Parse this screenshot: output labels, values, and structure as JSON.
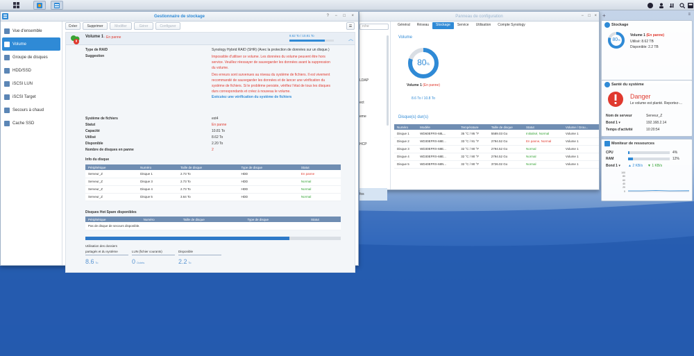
{
  "colors": {
    "accent": "#2f8ad6",
    "error": "#e0392e",
    "ok": "#33a233"
  },
  "taskbar": {
    "icons": [
      "grid-icon",
      "package-center-icon",
      "storage-manager-icon"
    ],
    "right_icons": [
      "chat-icon",
      "user-icon",
      "options-icon",
      "search-icon",
      "widgets-icon"
    ]
  },
  "storage_manager": {
    "title": "Gestionnaire de stockage",
    "sidebar": [
      {
        "label": "Vue d'ensemble",
        "icon": "overview-icon"
      },
      {
        "label": "Volume",
        "icon": "volume-icon"
      },
      {
        "label": "Groupe de disques",
        "icon": "disk-group-icon"
      },
      {
        "label": "HDD/SSD",
        "icon": "hdd-icon"
      },
      {
        "label": "iSCSI LUN",
        "icon": "lun-icon"
      },
      {
        "label": "iSCSI Target",
        "icon": "target-icon"
      },
      {
        "label": "Secours à chaud",
        "icon": "hotspare-icon"
      },
      {
        "label": "Cache SSD",
        "icon": "cache-icon"
      }
    ],
    "toolbar": {
      "create": "Créer",
      "delete": "Supprimer",
      "modify": "Modifier",
      "manage": "Gérer",
      "configure": "Configurer"
    },
    "volume": {
      "name": "Volume 1",
      "status_badge": "- En panne",
      "usage_text": "8.62 To / 10.81 To",
      "usage_fraction": 0.8,
      "fields": {
        "raid_label": "Type de RAID",
        "raid_value": "Synology Hybrid RAID (SHR) (Avec la protection de données sur un disque.)",
        "suggestion_label": "Suggestion",
        "suggestion_lines": [
          "Impossible d'utiliser ce volume. Les données du volume peuvent être hors",
          "service. Veuillez réessayer de sauvegarder les données avant la suppression",
          "du volume.",
          "Des erreurs sont survenues au niveau du système de fichiers. Il est vivement",
          "recommandé de sauvegarder les données et de lancer une vérification du",
          "système de fichiers. Si le problème persiste, vérifiez l'état de tous les disques",
          "durs correspondants et créez à nouveau le volume."
        ],
        "suggestion_link": "Exécutez une vérification du système de fichiers",
        "fs_label": "Système de fichiers",
        "fs_value": "ext4",
        "status_label": "Statut",
        "status_value": "En panne",
        "capacity_label": "Capacité",
        "capacity_value": "10.81 To",
        "used_label": "Utilisé",
        "used_value": "8.62 To",
        "avail_label": "Disponible",
        "avail_value": "2.20 To",
        "failed_label": "Nombre de disques en panne",
        "failed_value": "2"
      },
      "disk_info_title": "Info du disque",
      "disk_table": {
        "headers": [
          "Périphérique",
          "Numéro",
          "Taille de disque",
          "Type de disque",
          "Statut"
        ],
        "rows": [
          [
            "Serveur_Z",
            "Disque 1",
            "2.73 To",
            "HDD",
            "En panne"
          ],
          [
            "Serveur_Z",
            "Disque 3",
            "2.73 To",
            "HDD",
            "Normal"
          ],
          [
            "Serveur_Z",
            "Disque 4",
            "2.73 To",
            "HDD",
            "Normal"
          ],
          [
            "Serveur_Z",
            "Disque 5",
            "3.64 To",
            "HDD",
            "Normal"
          ]
        ]
      },
      "hotspare_title": "Disques Hot Spare disponibles",
      "hotspare_table": {
        "headers": [
          "Périphérique",
          "Numéro",
          "Taille de disque",
          "Type de disque",
          "Statut"
        ],
        "empty": "Pas de disque de secours disponible."
      },
      "usage_bar_fraction": 0.8,
      "stats": [
        {
          "label_line1": "Utilisation des dossiers",
          "label_line2": "partagés et du système",
          "value": "8.6",
          "unit": "To"
        },
        {
          "label_line1": "",
          "label_line2": "LUN (fichier courants)",
          "value": "0",
          "unit": "Octets"
        },
        {
          "label_line1": "",
          "label_line2": "Disponible",
          "value": "2.2",
          "unit": "To"
        }
      ]
    }
  },
  "config_panel": {
    "title": "Panneau de configuration",
    "tabs": [
      "Général",
      "Réseau",
      "Stockage",
      "Service",
      "Utilisation",
      "Compte Synology"
    ],
    "partial_left": [
      "LDAP",
      "ect",
      "eme",
      "HCP",
      "fos"
    ],
    "search_placeholder": "rche",
    "volume_section": "Volume",
    "donut_percent": "80",
    "donut_fraction": 0.8,
    "volume_name": "Volume 1",
    "volume_status": "(En panne)",
    "volume_size": "8.6 To / 10.8 To",
    "disks_section": "Disque(s) dur(s)",
    "disk_table": {
      "headers": [
        "Numéro",
        "Modèle",
        "Température",
        "Taille de disque",
        "Statut",
        "Volume / Grou..."
      ],
      "rows": [
        [
          "Disque 1",
          "WD60EFRX-68L...",
          "35 °C / 95 °F",
          "5589.03 Go",
          "Initialisé, Normal",
          "Volume 1"
        ],
        [
          "Disque 2",
          "WD30EFRX-68E...",
          "33 °C / 91 °F",
          "2794.52 Go",
          "En panne, Normal",
          "Volume 1"
        ],
        [
          "Disque 3",
          "WD30EFRX-68E...",
          "32 °C / 90 °F",
          "2794.52 Go",
          "Normal",
          "Volume 1"
        ],
        [
          "Disque 4",
          "WD30EFRX-68E...",
          "32 °C / 90 °F",
          "2794.52 Go",
          "Normal",
          "Volume 1"
        ],
        [
          "Disque 5",
          "WD40EFRX-68N...",
          "32 °C / 90 °F",
          "3726.02 Go",
          "Normal",
          "Volume 1"
        ]
      ]
    }
  },
  "widgets": {
    "storage": {
      "title": "Stockage",
      "percent": "80",
      "volume": "Volume 1",
      "status": "(En panne)",
      "used": "Utilisé: 8.62 TB",
      "available": "Disponible: 2.2 TB"
    },
    "health": {
      "title": "Santé du système",
      "state": "Danger",
      "message": "Le volume est planté. Reportez-...",
      "rows": [
        {
          "k": "Nom de serveur",
          "v": "Serveur_Z"
        },
        {
          "k": "Bond 1 ▾",
          "v": "192.168.2.14"
        },
        {
          "k": "Temps d'activité",
          "v": "10:20:54"
        }
      ]
    },
    "monitor": {
      "title": "Moniteur de ressources",
      "cpu_label": "CPU",
      "cpu_value": "4%",
      "cpu_fraction": 0.04,
      "ram_label": "RAM",
      "ram_value": "12%",
      "ram_fraction": 0.12,
      "net_label": "Bond 1 ▾",
      "up": "2 KB/s",
      "down": "1 KB/s",
      "y_ticks": [
        "100",
        "80",
        "60",
        "40",
        "20",
        "0"
      ]
    }
  }
}
